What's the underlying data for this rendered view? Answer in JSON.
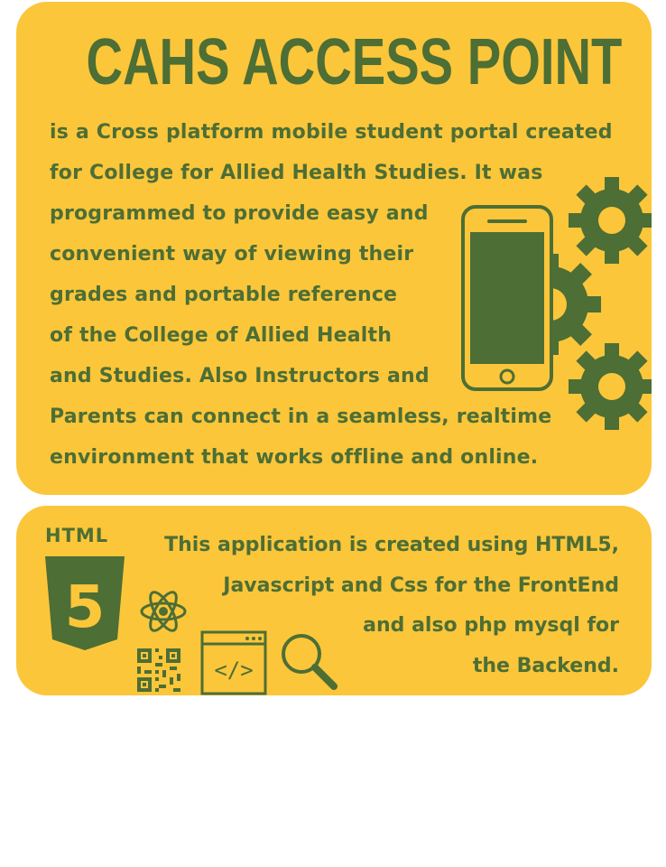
{
  "title": "CAHS ACCESS POINT",
  "description": [
    "is a Cross platform mobile student portal created",
    "for College for Allied Health Studies. It was",
    "programmed to provide easy and",
    "convenient way of viewing their",
    "grades and portable reference",
    "of the College of Allied Health",
    "and Studies. Also Instructors and",
    "Parents can connect in a seamless, realtime",
    "environment that works offline and online."
  ],
  "tech": {
    "html_label": "HTML",
    "html_badge_number": "5",
    "code_symbol": "</>",
    "lines": [
      "This application is created using HTML5,",
      "Javascript and Css for the FrontEnd",
      "and also php mysql for",
      "the Backend."
    ]
  },
  "colors": {
    "card": "#fbc63a",
    "accent": "#4d6e35",
    "background": "#ffffff"
  },
  "icons": [
    "smartphone-icon",
    "gear-icon",
    "html5-icon",
    "atom-icon",
    "qr-code-icon",
    "code-window-icon",
    "magnifier-icon"
  ]
}
